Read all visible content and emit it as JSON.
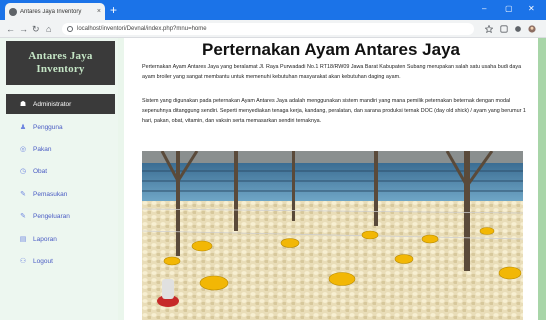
{
  "browser": {
    "tab_title": "Antares Jaya Inventory",
    "tab_close": "×",
    "new_tab": "+",
    "url": "localhost/inventori/Devnal/index.php?mnu=home",
    "win_minimize": "–",
    "win_maximize": "▢",
    "win_close": "✕"
  },
  "sidebar": {
    "brand_line1": "Antares Jaya",
    "brand_line2": "Inventory",
    "items": [
      {
        "label": "Administrator",
        "icon": "tachometer-icon",
        "glyph": "☗",
        "active": true
      },
      {
        "label": "Pengguna",
        "icon": "user-icon",
        "glyph": "♟",
        "active": false
      },
      {
        "label": "Pakan",
        "icon": "feed-icon",
        "glyph": "◎",
        "active": false
      },
      {
        "label": "Obat",
        "icon": "medicine-icon",
        "glyph": "◷",
        "active": false
      },
      {
        "label": "Pemasukan",
        "icon": "pencil-icon",
        "glyph": "✎",
        "active": false
      },
      {
        "label": "Pengeluaran",
        "icon": "pencil-icon",
        "glyph": "✎",
        "active": false
      },
      {
        "label": "Laporan",
        "icon": "report-icon",
        "glyph": "▤",
        "active": false
      },
      {
        "label": "Logout",
        "icon": "logout-icon",
        "glyph": "⚇",
        "active": false
      }
    ]
  },
  "main": {
    "title": "Perternakan Ayam Antares Jaya",
    "paragraph1": "Perternakan Ayam Antares Jaya yang beralamat Jl. Raya Purwadadi No.1 RT18/RW09 Jawa Barat Kabupaten Subang merupakan salah satu usaha budi daya ayam broiler yang sangat membantu untuk memenuhi kebutuhan masyarakat akan kebutuhan daging ayam.",
    "paragraph2": "Sistem yang digunakan pada peternakan Ayam Antares Jaya adalah menggunakan sistem mandiri yang mana pemilik peternakan beternak dengan modal sepenuhnya ditanggung sendiri. Seperti menyediakan tenaga kerja, kandang, peralatan, dan sarana produksi ternak DOC (day old shick) / ayam yang berumur 1 hari, pakan, obat, vitamin, dan vaksin serta memasarkan sendiri ternaknya."
  },
  "colors": {
    "sidebar_dark": "#3a3a3a",
    "brand_text": "#c5e6c6",
    "menu_link": "#4a5cc4",
    "page_bg": "#eaf6ec",
    "chrome_blue": "#1b73e8"
  }
}
